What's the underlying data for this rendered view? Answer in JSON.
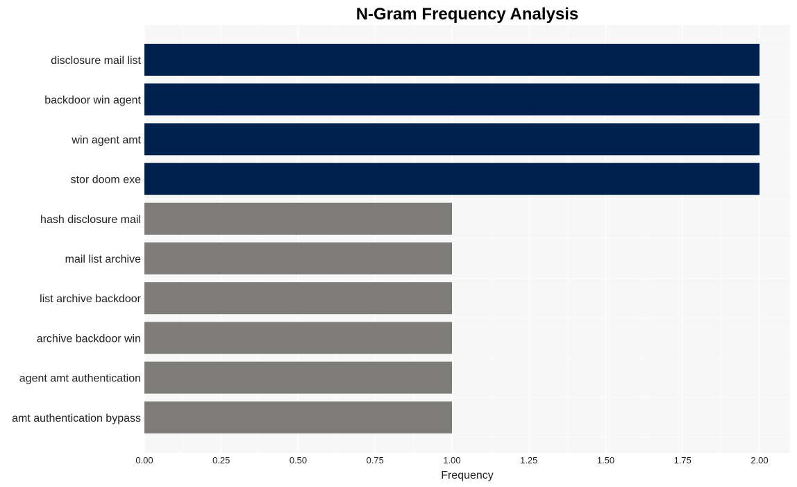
{
  "chart_data": {
    "type": "bar",
    "orientation": "horizontal",
    "title": "N-Gram Frequency Analysis",
    "xlabel": "Frequency",
    "ylabel": "",
    "xlim": [
      0,
      2.1
    ],
    "xticks": [
      0.0,
      0.25,
      0.5,
      0.75,
      1.0,
      1.25,
      1.5,
      1.75,
      2.0
    ],
    "xtick_labels": [
      "0.00",
      "0.25",
      "0.50",
      "0.75",
      "1.00",
      "1.25",
      "1.50",
      "1.75",
      "2.00"
    ],
    "grid": true,
    "categories": [
      "disclosure mail list",
      "backdoor win agent",
      "win agent amt",
      "stor doom exe",
      "hash disclosure mail",
      "mail list archive",
      "list archive backdoor",
      "archive backdoor win",
      "agent amt authentication",
      "amt authentication bypass"
    ],
    "values": [
      2,
      2,
      2,
      2,
      1,
      1,
      1,
      1,
      1,
      1
    ],
    "colors": {
      "high": "#00214d",
      "low": "#7d7c78",
      "plot_background": "#f7f7f7",
      "grid": "#ffffff"
    }
  }
}
